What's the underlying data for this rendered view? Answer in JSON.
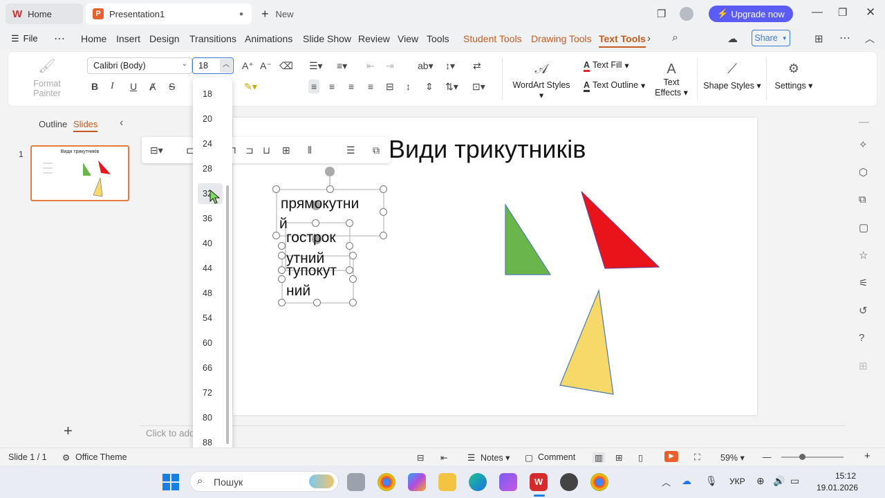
{
  "tabs": {
    "home": "Home",
    "presentation": "Presentation1",
    "new": "New"
  },
  "header": {
    "upgrade": "Upgrade now"
  },
  "menu": {
    "file": "File",
    "items": [
      "Home",
      "Insert",
      "Design",
      "Transitions",
      "Animations",
      "Slide Show",
      "Review",
      "View",
      "Tools",
      "Student Tools",
      "Drawing Tools",
      "Text Tools"
    ],
    "share": "Share"
  },
  "ribbon": {
    "format_painter": "Format Painter",
    "font_name": "Calibri (Body)",
    "font_size": "18",
    "text_fill": "Text Fill",
    "text_outline": "Text Outline",
    "wordart": "WordArt Styles",
    "text_effects_1": "Text",
    "text_effects_2": "Effects",
    "shape_styles": "Shape Styles",
    "settings": "Settings",
    "bold": "B",
    "italic": "I",
    "underline": "U",
    "strike": "S"
  },
  "font_sizes": [
    "18",
    "20",
    "24",
    "28",
    "32",
    "36",
    "40",
    "44",
    "48",
    "54",
    "60",
    "66",
    "72",
    "80",
    "88"
  ],
  "left_pane": {
    "outline": "Outline",
    "slides": "Slides",
    "slide_num": "1",
    "thumb_title": "Види трикутників"
  },
  "slide": {
    "title": "Види трикутників",
    "textbox1": [
      "прямокутни",
      "й"
    ],
    "textbox2": [
      "гострок",
      "утний"
    ],
    "textbox3": [
      "тупокут",
      "ний"
    ],
    "triangle_colors": {
      "green": "#6ab64a",
      "red": "#e8141a",
      "yellow": "#f7d96a"
    }
  },
  "notes_placeholder": "Click to add notes",
  "status": {
    "slide": "Slide 1 / 1",
    "theme": "Office Theme",
    "notes": "Notes",
    "comment": "Comment",
    "zoom": "59%"
  },
  "taskbar": {
    "search": "Пошук",
    "lang": "УКР",
    "time": "15:12",
    "date": "19.01.2026"
  },
  "colors": {
    "accent": "#c65a1e",
    "upgrade_bg": "#5b5bf6",
    "selection_blue": "#3c7ad6"
  }
}
